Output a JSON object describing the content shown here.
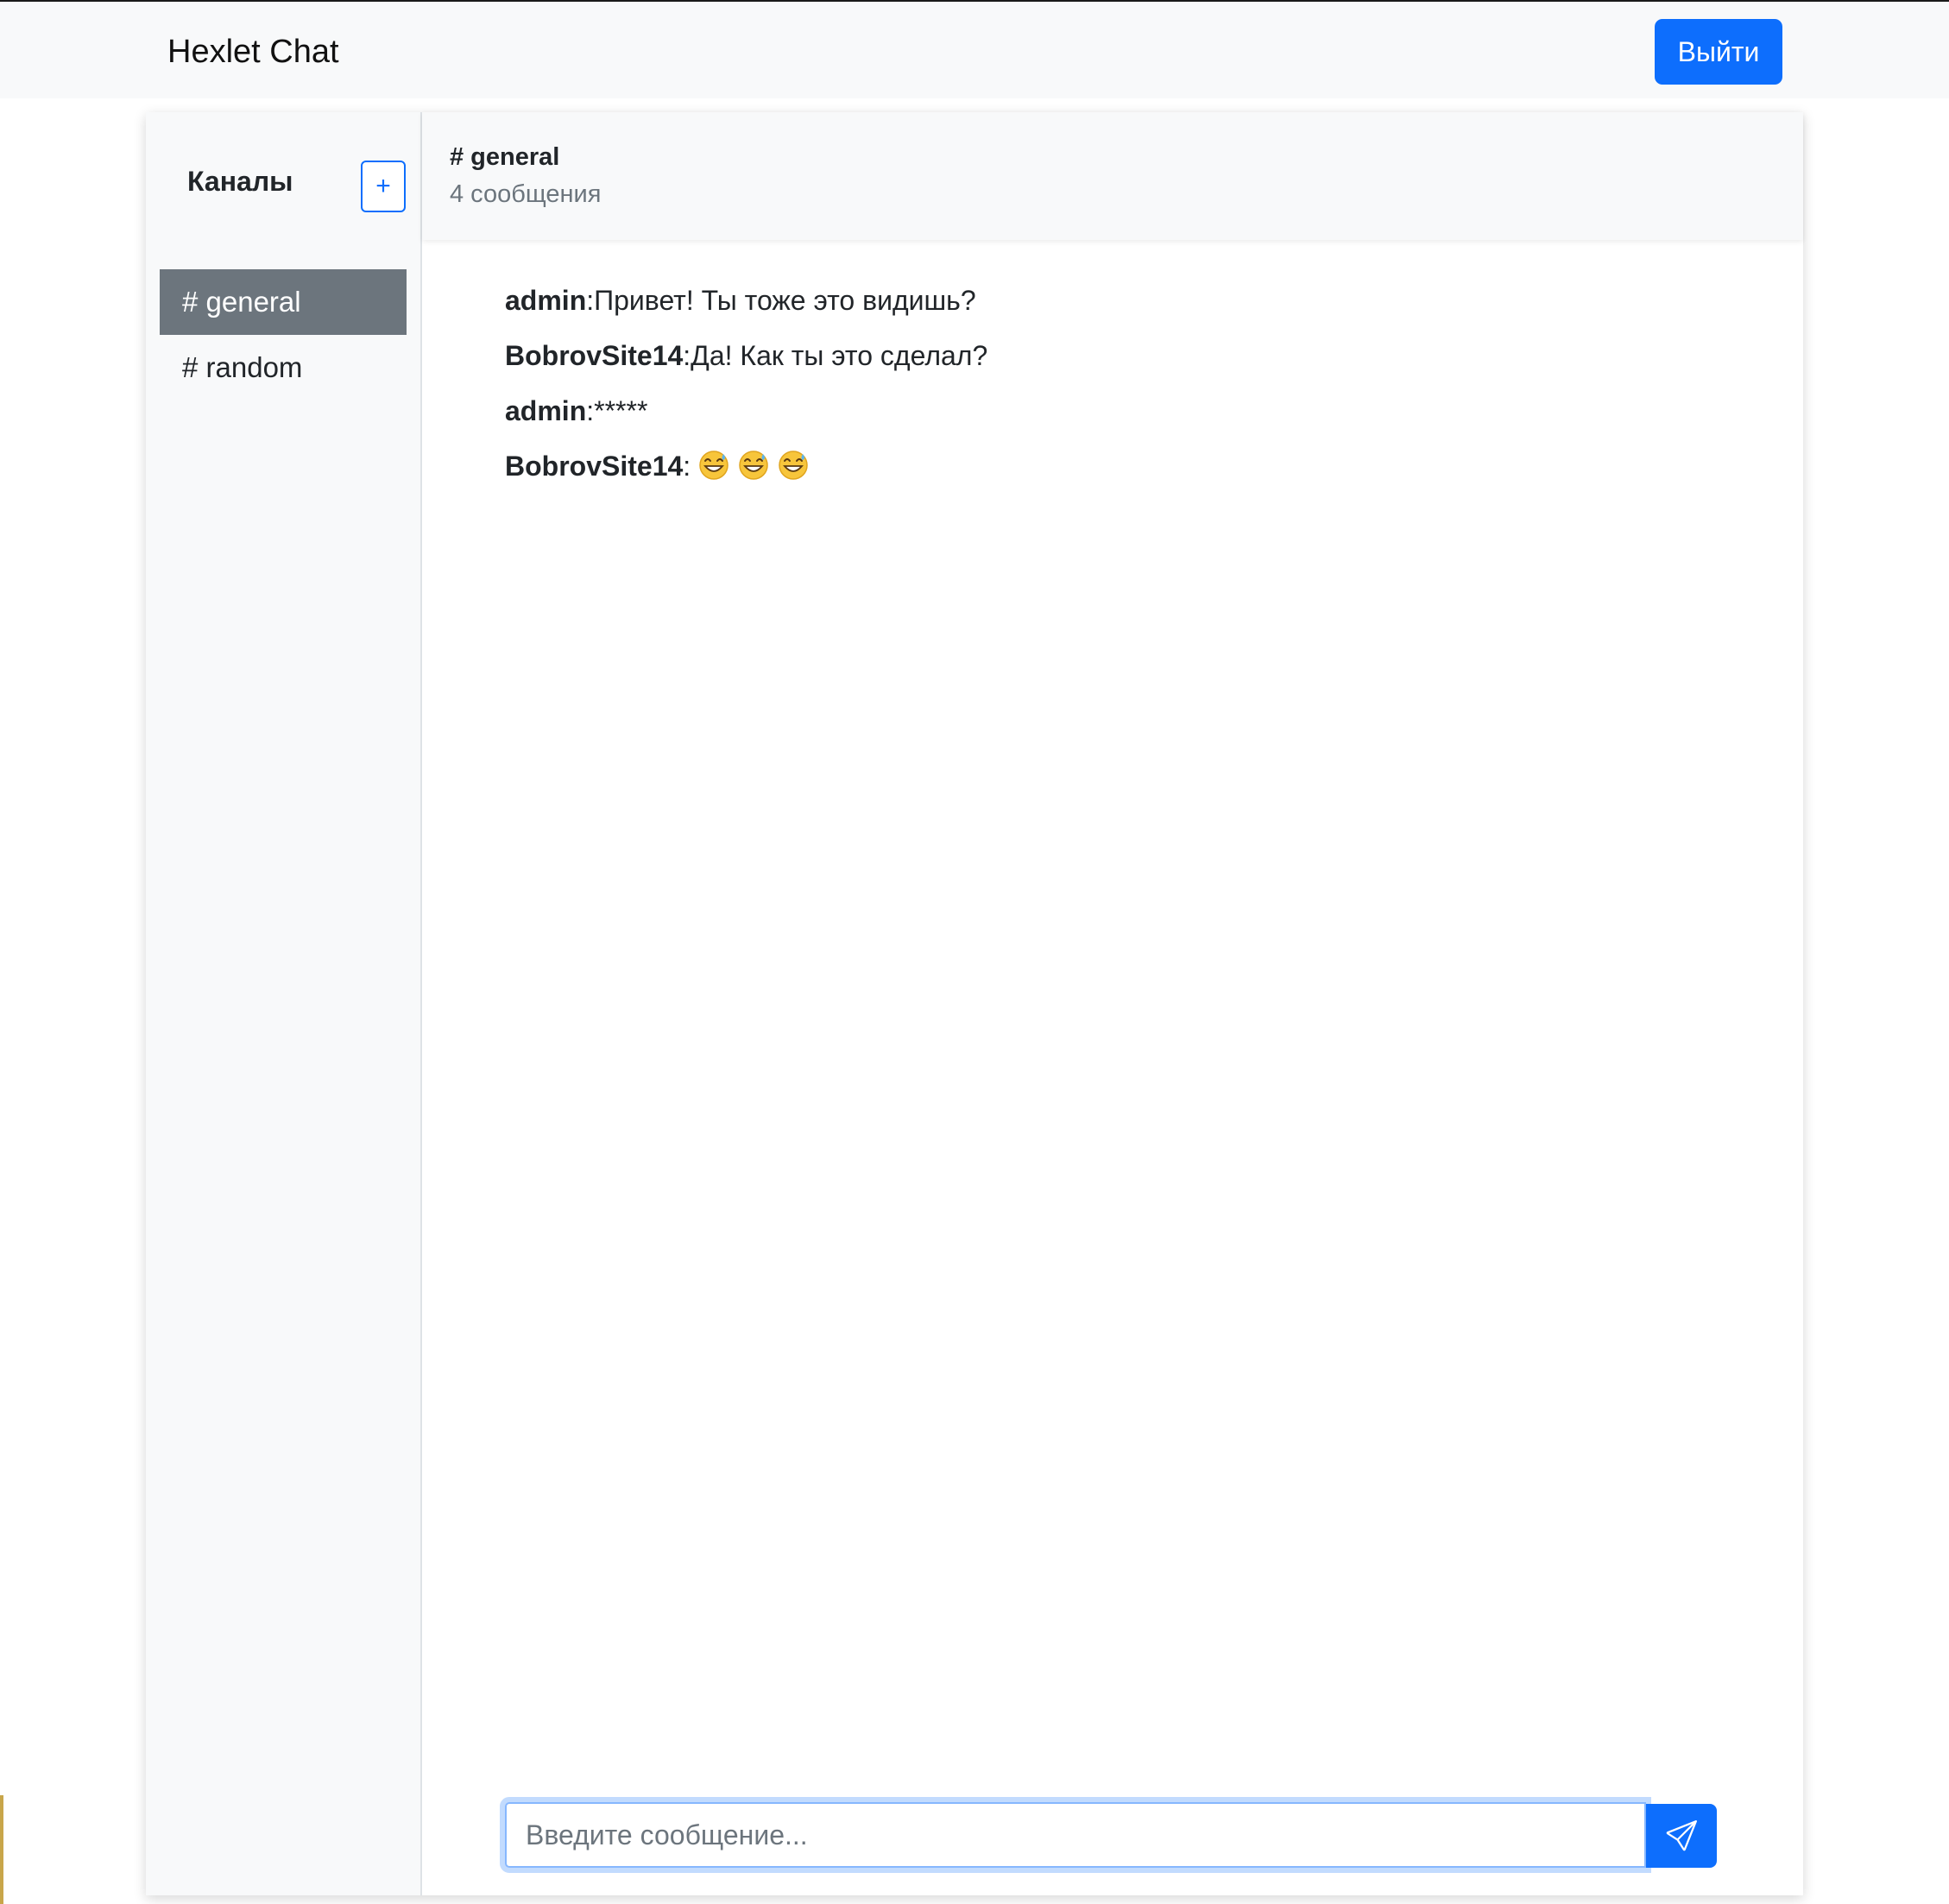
{
  "navbar": {
    "brand": "Hexlet Chat",
    "logout_label": "Выйти",
    "accent_color": "#0d6efd"
  },
  "sidebar": {
    "title": "Каналы",
    "add_label": "+",
    "channels": [
      {
        "label": "# general",
        "active": true
      },
      {
        "label": "# random",
        "active": false
      }
    ]
  },
  "chat": {
    "name": "# general",
    "count": "4 сообщения",
    "messages": [
      {
        "author": "admin",
        "text": ":Привет! Ты тоже это видишь?"
      },
      {
        "author": "BobrovSite14",
        "text": ":Да! Как ты это сделал?"
      },
      {
        "author": "admin",
        "text": ":*****"
      },
      {
        "author": "BobrovSite14",
        "text": ":",
        "emoji": [
          "grinning-face-with-sweat",
          "grinning-face-with-sweat",
          "grinning-face-with-sweat"
        ]
      }
    ]
  },
  "composer": {
    "placeholder": "Введите сообщение...",
    "send_icon": "send-icon"
  }
}
